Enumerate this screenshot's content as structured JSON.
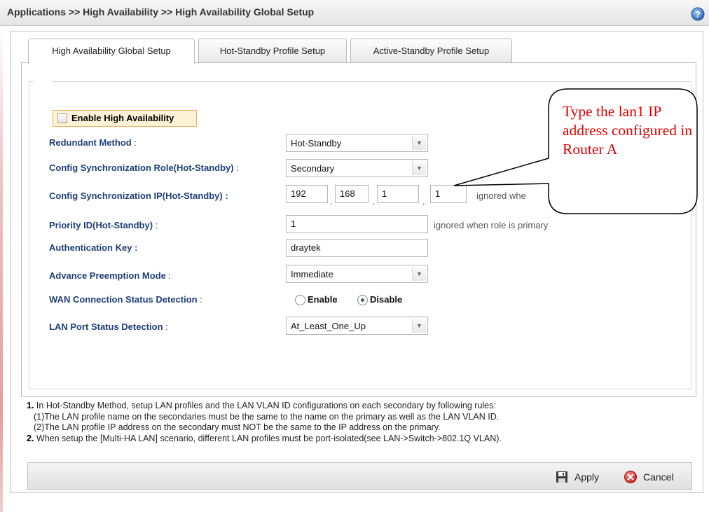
{
  "header": {
    "breadcrumb": "Applications >> High Availability >> High Availability Global Setup",
    "help_icon": "help-icon"
  },
  "tabs": [
    {
      "label": "High Availability Global Setup",
      "active": true
    },
    {
      "label": "Hot-Standby Profile Setup",
      "active": false
    },
    {
      "label": "Active-Standby Profile Setup",
      "active": false
    }
  ],
  "form": {
    "enable_ha": {
      "label": "Enable High Availability",
      "checked": false
    },
    "redundant_method": {
      "label": "Redundant Method",
      "value": "Hot-Standby"
    },
    "sync_role": {
      "label": "Config Synchronization Role(Hot-Standby)",
      "value": "Secondary"
    },
    "sync_ip": {
      "label": "Config Synchronization IP(Hot-Standby) :",
      "octets": [
        "192",
        "168",
        "1",
        "1"
      ],
      "hint": "ignored whe"
    },
    "priority_id": {
      "label": "Priority ID(Hot-Standby)",
      "value": "1",
      "hint": "ignored when role is primary"
    },
    "auth_key": {
      "label": "Authentication Key :",
      "value": "draytek"
    },
    "preemption": {
      "label": "Advance Preemption Mode",
      "value": "Immediate"
    },
    "wan_detection": {
      "label": "WAN Connection Status Detection",
      "options": [
        "Enable",
        "Disable"
      ],
      "selected": "Disable"
    },
    "lan_detection": {
      "label": "LAN Port Status Detection",
      "value": "At_Least_One_Up"
    },
    "colon": ":"
  },
  "notes": {
    "n1_num": "1.",
    "n1": "In Hot-Standby Method, setup LAN profiles and the LAN VLAN ID configurations on each secondary by following rules:",
    "n1a": "(1)The LAN profile name on the secondaries must be the same to the name on the primary as well as the LAN VLAN ID.",
    "n1b": "(2)The LAN profile IP address on the secondary must NOT be the same to the IP address on the primary.",
    "n2_num": "2.",
    "n2": "When setup the [Multi-HA LAN] scenario, different LAN profiles must be port-isolated(see LAN->Switch->802.1Q VLAN)."
  },
  "buttons": {
    "apply": "Apply",
    "cancel": "Cancel"
  },
  "callout": {
    "text": "Type the lan1 IP address configured in Router A",
    "color": "#e00000"
  },
  "colors": {
    "label_blue": "#1e3f78",
    "enable_highlight": "#fff2d6"
  }
}
